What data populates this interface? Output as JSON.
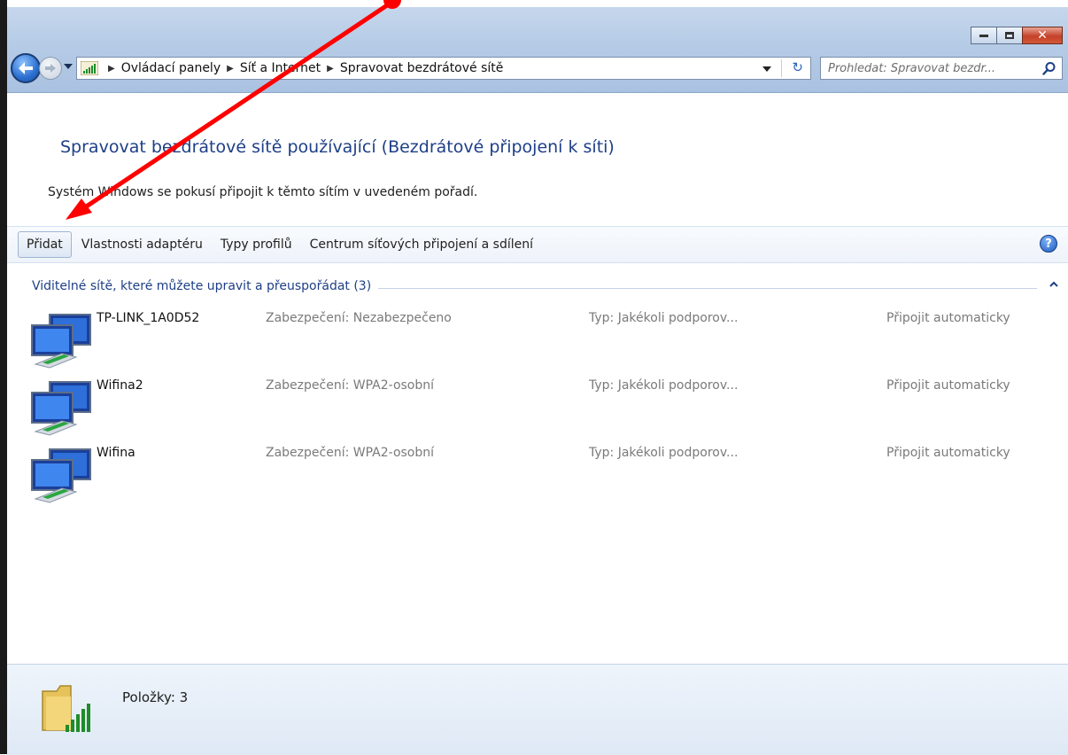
{
  "window": {
    "caption_buttons": [
      "minimize",
      "maximize",
      "close"
    ],
    "close_glyph": "✕"
  },
  "navigation": {
    "address_icon": "network-signal-icon",
    "breadcrumb": [
      "Ovládací panely",
      "Síť a Internet",
      "Spravovat bezdrátové sítě"
    ],
    "refresh_glyph": "↻",
    "search": {
      "placeholder": "Prohledat: Spravovat bezdr..."
    }
  },
  "main": {
    "heading": "Spravovat bezdrátové sítě používající (Bezdrátové připojení k síti)",
    "subtext": "Systém Windows se pokusí připojit k těmto sítím v uvedeném pořadí."
  },
  "toolbar": {
    "add_label": "Přidat",
    "adapter_label": "Vlastnosti adaptéru",
    "profiles_label": "Typy profilů",
    "center_label": "Centrum síťových připojení a sdílení",
    "help_glyph": "?"
  },
  "group": {
    "title": "Viditelné sítě, které můžete upravit a přeuspořádat (3)"
  },
  "networks": [
    {
      "name": "TP-LINK_1A0D52",
      "security": "Zabezpečení: Nezabezpečeno",
      "type": "Typ: Jakékoli podporov...",
      "mode": "Připojit automaticky"
    },
    {
      "name": "Wifina2",
      "security": "Zabezpečení: WPA2-osobní",
      "type": "Typ: Jakékoli podporov...",
      "mode": "Připojit automaticky"
    },
    {
      "name": "Wifina",
      "security": "Zabezpečení: WPA2-osobní",
      "type": "Typ: Jakékoli podporov...",
      "mode": "Připojit automaticky"
    }
  ],
  "details": {
    "items_count": "Položky: 3"
  },
  "colors": {
    "heading": "#1e3f87",
    "annotation_arrow": "#ff0000"
  }
}
